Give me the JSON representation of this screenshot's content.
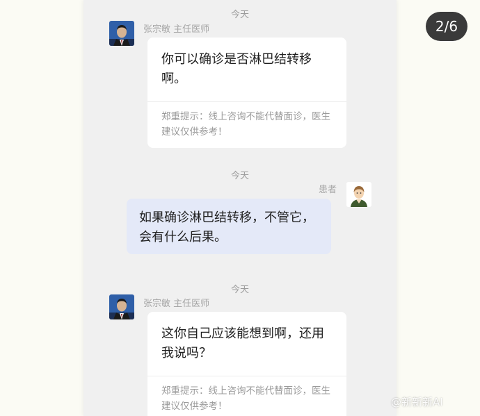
{
  "page_indicator": "2/6",
  "watermark": "@新新新AI",
  "messages": [
    {
      "time": "今天",
      "sender": "张宗敏 主任医师",
      "text": "你可以确诊是否淋巴结转移啊。",
      "note": "郑重提示：线上咨询不能代替面诊，医生建议仅供参考！"
    },
    {
      "time": "今天",
      "sender": "患者",
      "text": "如果确诊淋巴结转移，不管它，会有什么后果。"
    },
    {
      "time": "今天",
      "sender": "张宗敏 主任医师",
      "text": "这你自己应该能想到啊，还用我说吗？",
      "note": "郑重提示：线上咨询不能代替面诊，医生建议仅供参考！"
    }
  ],
  "colors": {
    "chat_background": "#f0f0f0",
    "doctor_bubble": "#ffffff",
    "patient_bubble": "#e4e9f8",
    "meta_text": "#9a9a9a"
  }
}
